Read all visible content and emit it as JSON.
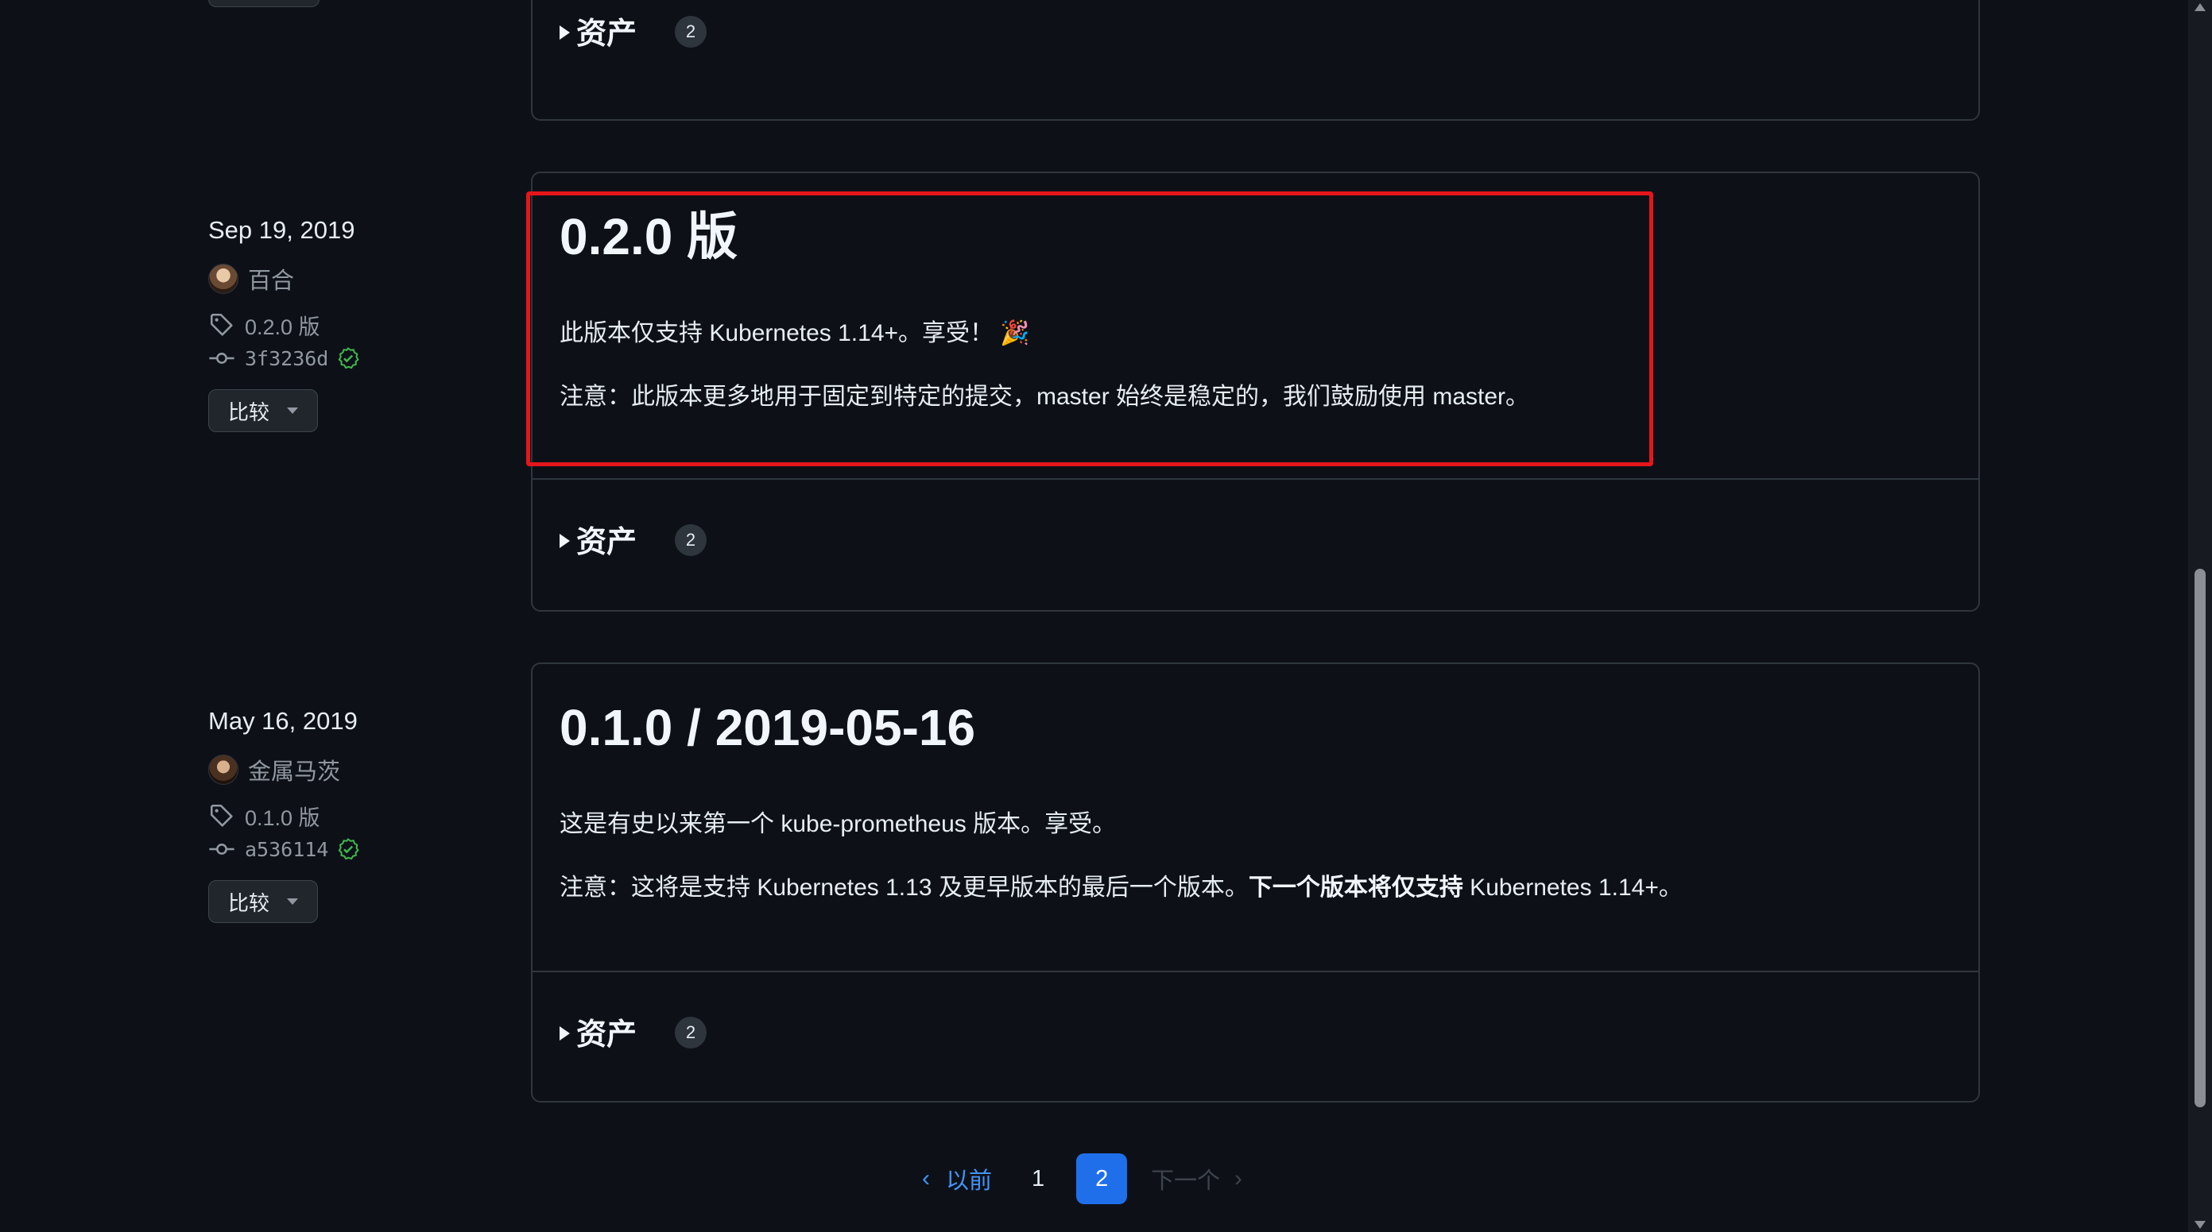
{
  "releases": [
    {
      "title": "0.2.0 版",
      "date": "Sep 19, 2019",
      "author": "百合",
      "tag": "0.2.0 版",
      "commit": "3f3236d",
      "compare_label": "比较",
      "line1": "此版本仅支持 Kubernetes 1.14+。享受！ 🎉",
      "line2": "注意：此版本更多地用于固定到特定的提交，master 始终是稳定的，我们鼓励使用 master。",
      "assets_label": "资产",
      "assets_count": "2"
    },
    {
      "title": "0.1.0 / 2019-05-16",
      "date": "May 16, 2019",
      "author": "金属马茨",
      "tag": "0.1.0 版",
      "commit": "a536114",
      "compare_label": "比较",
      "line1": "这是有史以来第一个 kube-prometheus 版本。享受。",
      "line2_plain": "注意：这将是支持 Kubernetes 1.13 及更早版本的最后一个版本。",
      "line2_bold": "下一个版本将仅支持",
      "line2_tail": " Kubernetes 1.14+。",
      "assets_label": "资产",
      "assets_count": "2"
    }
  ],
  "top_assets": {
    "label": "资产",
    "count": "2"
  },
  "pagination": {
    "prev": "以前",
    "pages": [
      "1",
      "2"
    ],
    "current": "2",
    "next": "下一个"
  },
  "colors": {
    "background": "#0d1117",
    "border": "#30363d",
    "link": "#4493f8",
    "current_page": "#1f6feb",
    "verified": "#3fb950",
    "highlight": "#e5161b"
  }
}
